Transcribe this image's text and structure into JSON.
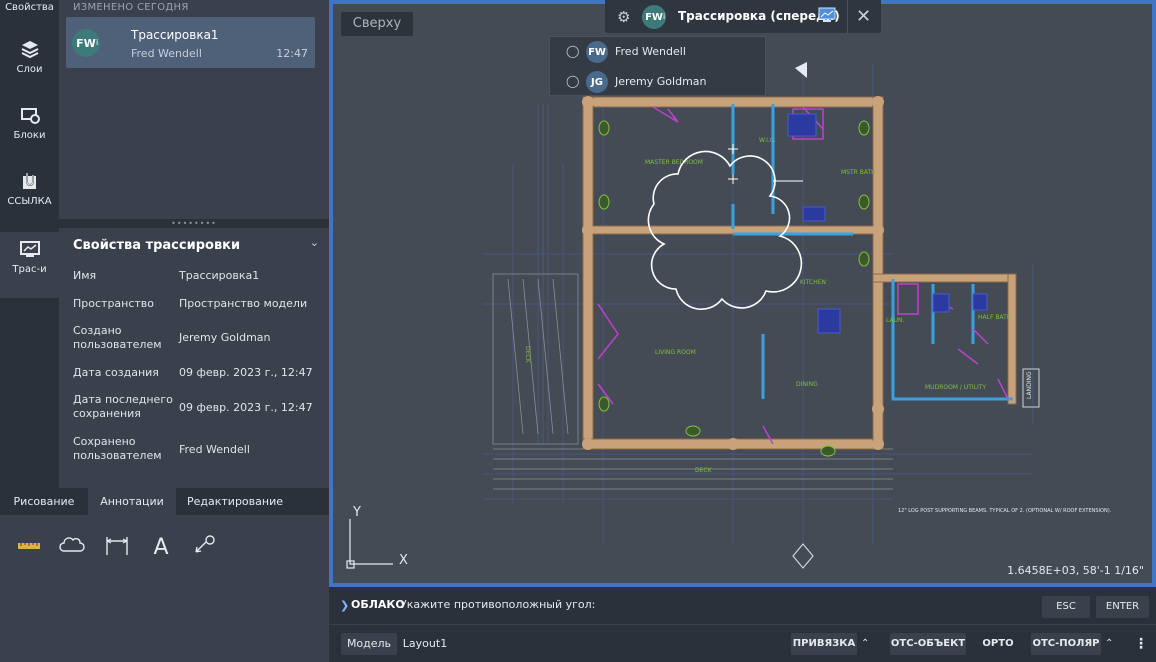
{
  "rail": {
    "items": [
      {
        "label": "Свойства",
        "icon": "properties-icon"
      },
      {
        "label": "Слои",
        "icon": "layers-icon"
      },
      {
        "label": "Блоки",
        "icon": "blocks-icon"
      },
      {
        "label": "ССЫЛКА",
        "icon": "xref-icon"
      },
      {
        "label": "Трас-и",
        "icon": "traces-icon"
      }
    ]
  },
  "traces": {
    "section": "ИЗМЕНЕНО СЕГОДНЯ",
    "card": {
      "initials": "FW",
      "info": "i",
      "name": "Трассировка1",
      "user": "Fred Wendell",
      "time": "12:47"
    }
  },
  "properties": {
    "title": "Свойства трассировки",
    "rows": [
      {
        "key": "Имя",
        "value": "Трассировка1"
      },
      {
        "key": "Пространство",
        "value": "Пространство модели"
      },
      {
        "key": "Создано пользователем",
        "value": "Jeremy Goldman"
      },
      {
        "key": "Дата создания",
        "value": "09 февр. 2023 г., 12:47"
      },
      {
        "key": "Дата последнего сохранения",
        "value": "09 февр. 2023 г., 12:47"
      },
      {
        "key": "Сохранено пользователем",
        "value": "Fred Wendell"
      }
    ]
  },
  "bottom_tabs": [
    "Рисование",
    "Аннотации",
    "Редактирование"
  ],
  "canvas": {
    "view_label": "Сверху",
    "coords": "1.6458E+03, 58'-1 1/16\"",
    "axis_y": "Y",
    "axis_x": "X"
  },
  "tracebar": {
    "initials": "FW",
    "info": "i",
    "title": "Трассировка (спереди)"
  },
  "users": [
    {
      "initials": "FW",
      "name": "Fred Wendell"
    },
    {
      "initials": "JG",
      "name": "Jeremy Goldman"
    }
  ],
  "command": {
    "keyword": "ОБЛАКО",
    "prompt": "Укажите противоположный угол:",
    "esc": "ESC",
    "enter": "ENTER"
  },
  "status": {
    "model_tab": "Модель",
    "layout_tab": "Layout1",
    "snap": "ПРИВЯЗКА",
    "otrack": "ОТС-ОБЪЕКТ",
    "ortho": "ОРТО",
    "polar": "ОТС-ПОЛЯР"
  },
  "plan_labels": {
    "master": "MASTER BEDROOM",
    "wic": "W.I.C.",
    "mstr_bath": "MSTR BATH",
    "kitchen": "KITCHEN",
    "living": "LIVING ROOM",
    "dining": "DINING",
    "laun": "LAUN.",
    "half_bath": "HALF BATH",
    "mudroom": "MUDROOM / UTILITY",
    "deck": "DECK",
    "deck_side": "DECK",
    "landing": "LANDING",
    "note": "12\" LOG POST SUPPORTING BEAMS. TYPICAL OF 2. (OPTIONAL W/ ROOF EXTENSION)."
  },
  "colors": {
    "accent": "#3f76c9",
    "log": "#c8a27a",
    "wall_blue": "#3aa0e0",
    "magenta": "#c040d0",
    "green_text": "#7fbf3f"
  }
}
